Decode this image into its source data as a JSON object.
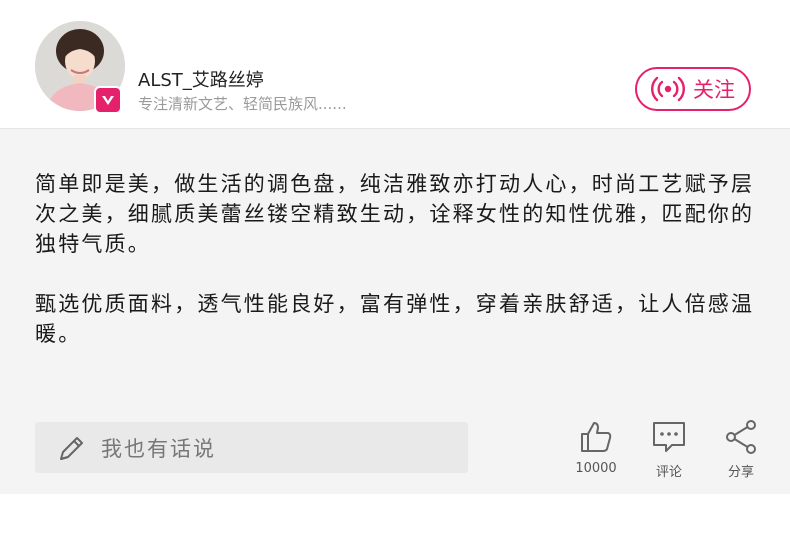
{
  "profile": {
    "username": "ALST_艾路丝婷",
    "bio": "专注清新文艺、轻简民族风......",
    "avatar_icon": "avatar-photo",
    "badge_icon": "verified-v-icon",
    "follow_label": "关注",
    "follow_icon": "live-broadcast-icon"
  },
  "post": {
    "paragraphs": [
      "简单即是美，做生活的调色盘，纯洁雅致亦打动人心，时尚工艺赋予层次之美，细腻质美蕾丝镂空精致生动，诠释女性的知性优雅，匹配你的独特气质。",
      "甄选优质面料，透气性能良好，富有弹性，穿着亲肤舒适，让人倍感温暖。"
    ]
  },
  "footer": {
    "comment_placeholder": "我也有话说",
    "like_count": "10000",
    "comment_label": "评论",
    "share_label": "分享"
  },
  "colors": {
    "accent": "#e5216b",
    "background": "#f4f4f4"
  }
}
